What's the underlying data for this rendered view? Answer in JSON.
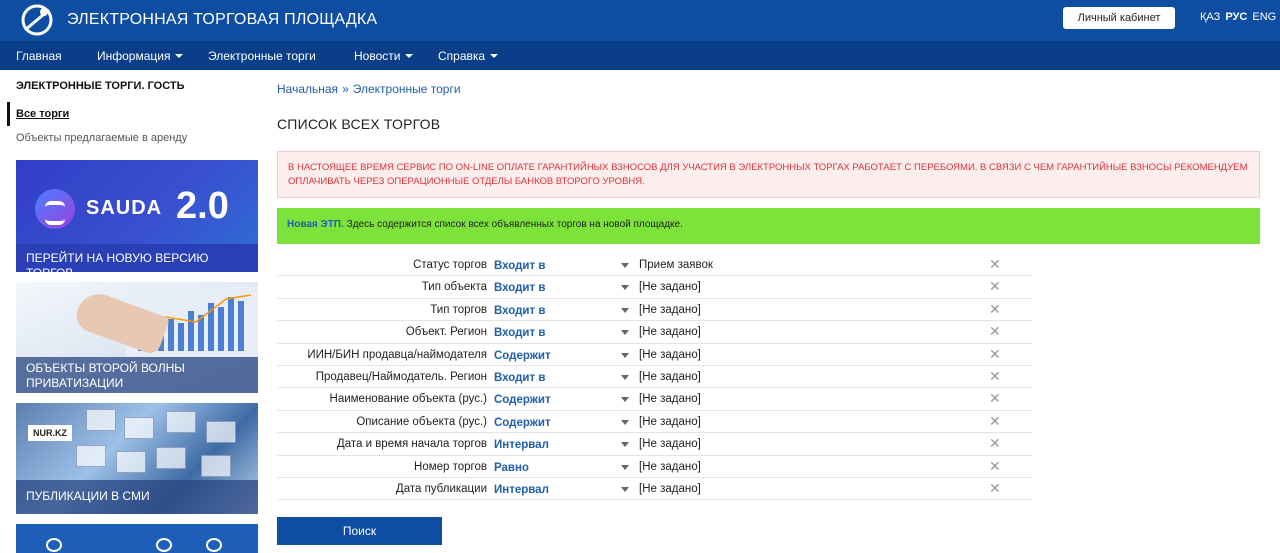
{
  "header": {
    "site_title": "ЭЛЕКТРОННАЯ ТОРГОВАЯ ПЛОЩАДКА",
    "cabinet_button": "Личный кабинет",
    "languages": [
      "ҚАЗ",
      "РУС",
      "ENG"
    ],
    "active_language": "РУС"
  },
  "nav": {
    "items": [
      {
        "label": "Главная",
        "has_dropdown": false
      },
      {
        "label": "Информация",
        "has_dropdown": true
      },
      {
        "label": "Электронные торги",
        "has_dropdown": false
      },
      {
        "label": "Новости",
        "has_dropdown": true
      },
      {
        "label": "Справка",
        "has_dropdown": true
      }
    ]
  },
  "sidebar": {
    "title": "ЭЛЕКТРОННЫЕ ТОРГИ. ГОСТЬ",
    "links": [
      "Все торги",
      "Объекты предлагаемые в аренду"
    ],
    "banners": [
      {
        "brand": "SAUDA",
        "version": "2.0",
        "caption": "ПЕРЕЙТИ НА НОВУЮ ВЕРСИЮ ТОРГОВ"
      },
      {
        "caption": "ОБЪЕКТЫ ВТОРОЙ ВОЛНЫ ПРИВАТИЗАЦИИ"
      },
      {
        "logo_text": "NUR.KZ",
        "caption": "ПУБЛИКАЦИИ В СМИ"
      }
    ]
  },
  "breadcrumb": {
    "home": "Начальная",
    "separator": "»",
    "current": "Электронные торги"
  },
  "main": {
    "title": "СПИСОК ВСЕХ ТОРГОВ",
    "warning": "В НАСТОЯЩЕЕ ВРЕМЯ СЕРВИС ПО ON-LINE ОПЛАТЕ ГАРАНТИЙНЫХ ВЗНОСОВ ДЛЯ УЧАСТИЯ В ЭЛЕКТРОННЫХ ТОРГАХ РАБОТАЕТ С ПЕРЕБОЯМИ. В СВЯЗИ С ЧЕМ ГАРАНТИЙНЫЕ ВЗНОСЫ РЕКОМЕНДУЕМ ОПЛАЧИВАТЬ ЧЕРЕЗ ОПЕРАЦИОННЫЕ ОТДЕЛЫ БАНКОВ ВТОРОГО УРОВНЯ.",
    "notice_lead": "Новая ЭТП.",
    "notice_text": "Здесь содержится список всех объявленных торгов на новой площадке.",
    "search_button": "Поиск"
  },
  "filters": [
    {
      "label": "Статус торгов",
      "operator": "Входит в",
      "value": "Прием заявок"
    },
    {
      "label": "Тип объекта",
      "operator": "Входит в",
      "value": "[Не задано]"
    },
    {
      "label": "Тип торгов",
      "operator": "Входит в",
      "value": "[Не задано]"
    },
    {
      "label": "Объект. Регион",
      "operator": "Входит в",
      "value": "[Не задано]"
    },
    {
      "label": "ИИН/БИН продавца/наймодателя",
      "operator": "Содержит",
      "value": "[Не задано]"
    },
    {
      "label": "Продавец/Наймодатель. Регион",
      "operator": "Входит в",
      "value": "[Не задано]"
    },
    {
      "label": "Наименование объекта (рус.)",
      "operator": "Содержит",
      "value": "[Не задано]"
    },
    {
      "label": "Описание объекта (рус.)",
      "operator": "Содержит",
      "value": "[Не задано]"
    },
    {
      "label": "Дата и время начала торгов",
      "operator": "Интервал",
      "value": "[Не задано]"
    },
    {
      "label": "Номер торгов",
      "operator": "Равно",
      "value": "[Не задано]"
    },
    {
      "label": "Дата публикации",
      "operator": "Интервал",
      "value": "[Не задано]"
    }
  ],
  "colors": {
    "header_bg": "#0d4ea3",
    "nav_bg": "#0a3e89",
    "link": "#1f5fa8",
    "warning_text": "#d9333b",
    "notice_bg": "#7de33b"
  }
}
